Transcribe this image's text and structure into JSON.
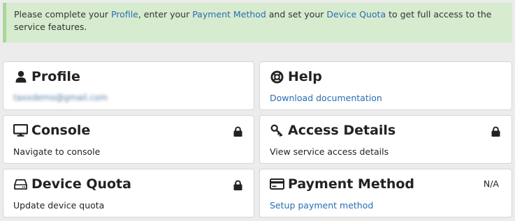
{
  "alert": {
    "text_before_profile": "Please complete your ",
    "profile_link": "Profile",
    "text_before_payment": ", enter your ",
    "payment_link": "Payment Method",
    "text_before_quota": " and set your ",
    "quota_link": "Device Quota",
    "text_after": " to get full access to the service features."
  },
  "cards": {
    "profile": {
      "title": "Profile",
      "icon": "user-icon",
      "subtitle": "taxxdemo@gmail.com"
    },
    "help": {
      "title": "Help",
      "icon": "lifebuoy-icon",
      "subtitle": "Download documentation"
    },
    "console": {
      "title": "Console",
      "icon": "monitor-icon",
      "subtitle": "Navigate to console",
      "locked": true
    },
    "access": {
      "title": "Access Details",
      "icon": "key-icon",
      "subtitle": "View service access details",
      "locked": true
    },
    "quota": {
      "title": "Device Quota",
      "icon": "hard-drive-icon",
      "subtitle": "Update device quota",
      "locked": true
    },
    "payment": {
      "title": "Payment Method",
      "icon": "credit-card-icon",
      "subtitle": "Setup payment method",
      "status": "N/A"
    }
  },
  "colors": {
    "alert_bg": "#d7ebcf",
    "alert_border": "#a9d79a",
    "link": "#2a6db0",
    "page_bg": "#ececec"
  }
}
